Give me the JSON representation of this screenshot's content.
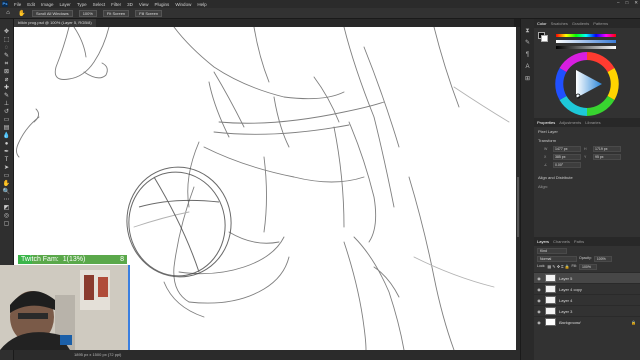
{
  "menubar": {
    "logo": "Ps",
    "items": [
      "File",
      "Edit",
      "Image",
      "Layer",
      "Type",
      "Select",
      "Filter",
      "3D",
      "View",
      "Plugins",
      "Window",
      "Help"
    ],
    "window_controls": [
      "–",
      "□",
      "✕"
    ]
  },
  "options": {
    "scroll_all": "Scroll All Windows",
    "zoom": "100%",
    "fit_screen": "Fit Screen",
    "fill_screen": "Fill Screen"
  },
  "document": {
    "tab_title": "bilkin prog.psd @ 100% (Layer 5, RGB/8)"
  },
  "status": {
    "text": "1895 px x 1500 px (72 ppi)"
  },
  "panels": {
    "color_tabs": [
      "Color",
      "Swatches",
      "Gradients",
      "Patterns"
    ],
    "properties_tabs": [
      "Properties",
      "Adjustments",
      "Libraries"
    ],
    "properties": {
      "kind": "Pixel Layer",
      "transform_label": "Transform",
      "w": "1477 px",
      "h": "1719 px",
      "x": "385 px",
      "y": "95 px",
      "angle": "0.00°",
      "align_label": "Align and Distribute",
      "align_sub": "Align:"
    },
    "layers_tabs": [
      "Layers",
      "Channels",
      "Paths"
    ],
    "kind_filter": "Kind",
    "blend_mode": "Normal",
    "opacity_label": "Opacity:",
    "opacity": "100%",
    "lock_label": "Lock:",
    "fill_label": "Fill:",
    "fill": "100%",
    "layers": [
      {
        "name": "Layer 5",
        "selected": true,
        "italic": false
      },
      {
        "name": "Layer 4 copy",
        "selected": false,
        "italic": false
      },
      {
        "name": "Layer 4",
        "selected": false,
        "italic": false
      },
      {
        "name": "Layer 3",
        "selected": false,
        "italic": false
      },
      {
        "name": "Background",
        "selected": false,
        "italic": true
      }
    ]
  },
  "twitch": {
    "label": "Twitch Fam:",
    "progress_text": "1(13%)",
    "progress": 0.13,
    "count": "8"
  },
  "colors": {
    "accent": "#3bb54a",
    "webcam_border": "#3b7fe0"
  }
}
